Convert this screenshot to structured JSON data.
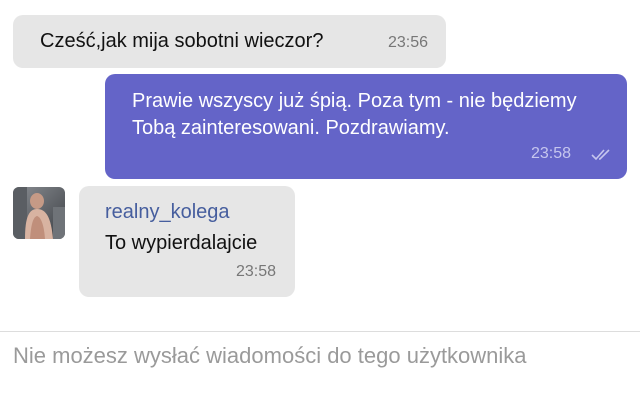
{
  "colors": {
    "incoming_bubble": "#e6e6e6",
    "outgoing_bubble": "#6464c8",
    "sender_name": "#465e9e",
    "outgoing_text": "#ffffff",
    "timestamp_in": "#777777",
    "timestamp_out": "#c6c6ee",
    "notice_text": "#9a9a9a"
  },
  "messages": [
    {
      "direction": "incoming",
      "text": "Cześć,jak mija sobotni wieczor?",
      "time": "23:56"
    },
    {
      "direction": "outgoing",
      "text": "Prawie wszyscy już śpią. Poza tym - nie będziemy Tobą zainteresowani. Pozdrawiamy.",
      "time": "23:58",
      "status_icon": "double-check-icon"
    },
    {
      "direction": "incoming",
      "sender": "realny_kolega",
      "avatar_icon": "user-avatar",
      "text": "To wypierdalajcie",
      "time": "23:58"
    }
  ],
  "composer": {
    "notice": "Nie możesz wysłać wiadomości do tego użytkownika"
  }
}
